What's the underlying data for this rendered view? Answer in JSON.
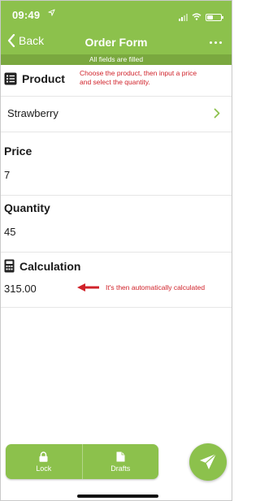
{
  "status": {
    "time": "09:49"
  },
  "nav": {
    "back_label": "Back",
    "title": "Order Form"
  },
  "banner": {
    "text": "All fields are filled"
  },
  "product": {
    "heading": "Product",
    "value": "Strawberry",
    "annotation": "Choose the product, then input a price and select the quantity."
  },
  "price": {
    "heading": "Price",
    "value": "7"
  },
  "quantity": {
    "heading": "Quantity",
    "value": "45"
  },
  "calculation": {
    "heading": "Calculation",
    "value": "315.00",
    "annotation": "It's then automatically calculated"
  },
  "toolbar": {
    "lock_label": "Lock",
    "drafts_label": "Drafts"
  },
  "colors": {
    "accent": "#8cc14c",
    "banner": "#7aa83f",
    "annotation": "#d0222a"
  },
  "icons": {
    "location": "location-arrow-icon",
    "back": "chevron-left-icon",
    "more": "more-dots-icon",
    "product": "list-icon",
    "chevron": "chevron-right-icon",
    "calculation": "calculator-icon",
    "arrow": "red-arrow-icon",
    "lock": "lock-icon",
    "drafts": "document-icon",
    "send": "paper-plane-icon"
  }
}
